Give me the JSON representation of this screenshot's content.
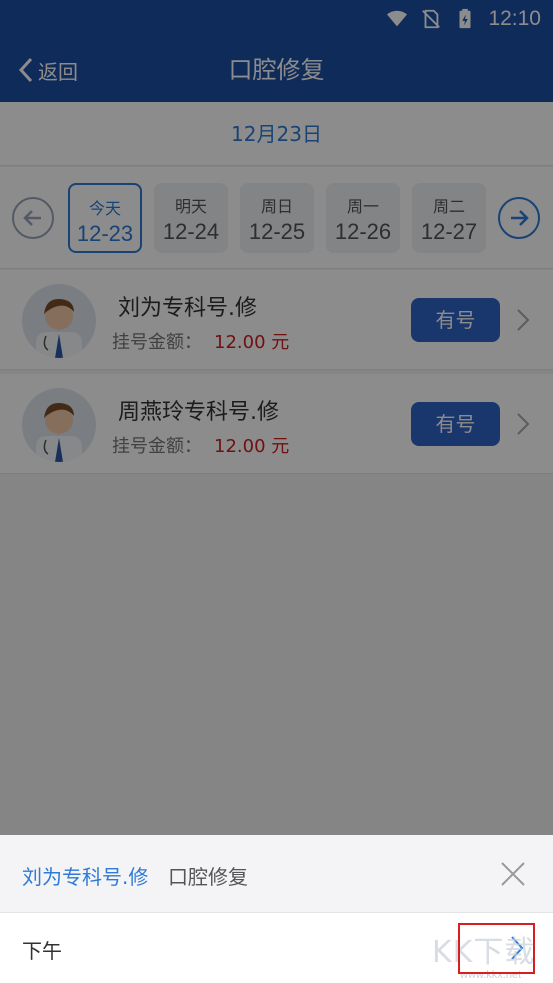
{
  "status_bar": {
    "time": "12:10"
  },
  "nav": {
    "back_label": "返回",
    "title": "口腔修复"
  },
  "date_header": {
    "date": "12月23日"
  },
  "days": [
    {
      "weekday": "今天",
      "date": "12-23",
      "active": true
    },
    {
      "weekday": "明天",
      "date": "12-24"
    },
    {
      "weekday": "周日",
      "date": "12-25"
    },
    {
      "weekday": "周一",
      "date": "12-26"
    },
    {
      "weekday": "周二",
      "date": "12-27"
    }
  ],
  "doctors": [
    {
      "name": "刘为专科号.修",
      "fee_label": "挂号金额：",
      "fee": "12.00 元",
      "status": "有号"
    },
    {
      "name": "周燕玲专科号.修",
      "fee_label": "挂号金额：",
      "fee": "12.00 元",
      "status": "有号"
    }
  ],
  "sheet": {
    "doctor": "刘为专科号.修",
    "department": "口腔修复",
    "period": "下午"
  },
  "watermark": {
    "text": "KK下载",
    "url": "www.kkx.net"
  },
  "colors": {
    "primary": "#1d4fa3",
    "accent": "#2e7ad6",
    "button": "#2f63c7",
    "fee": "#cc1f1f",
    "highlight": "#d91e1e"
  }
}
